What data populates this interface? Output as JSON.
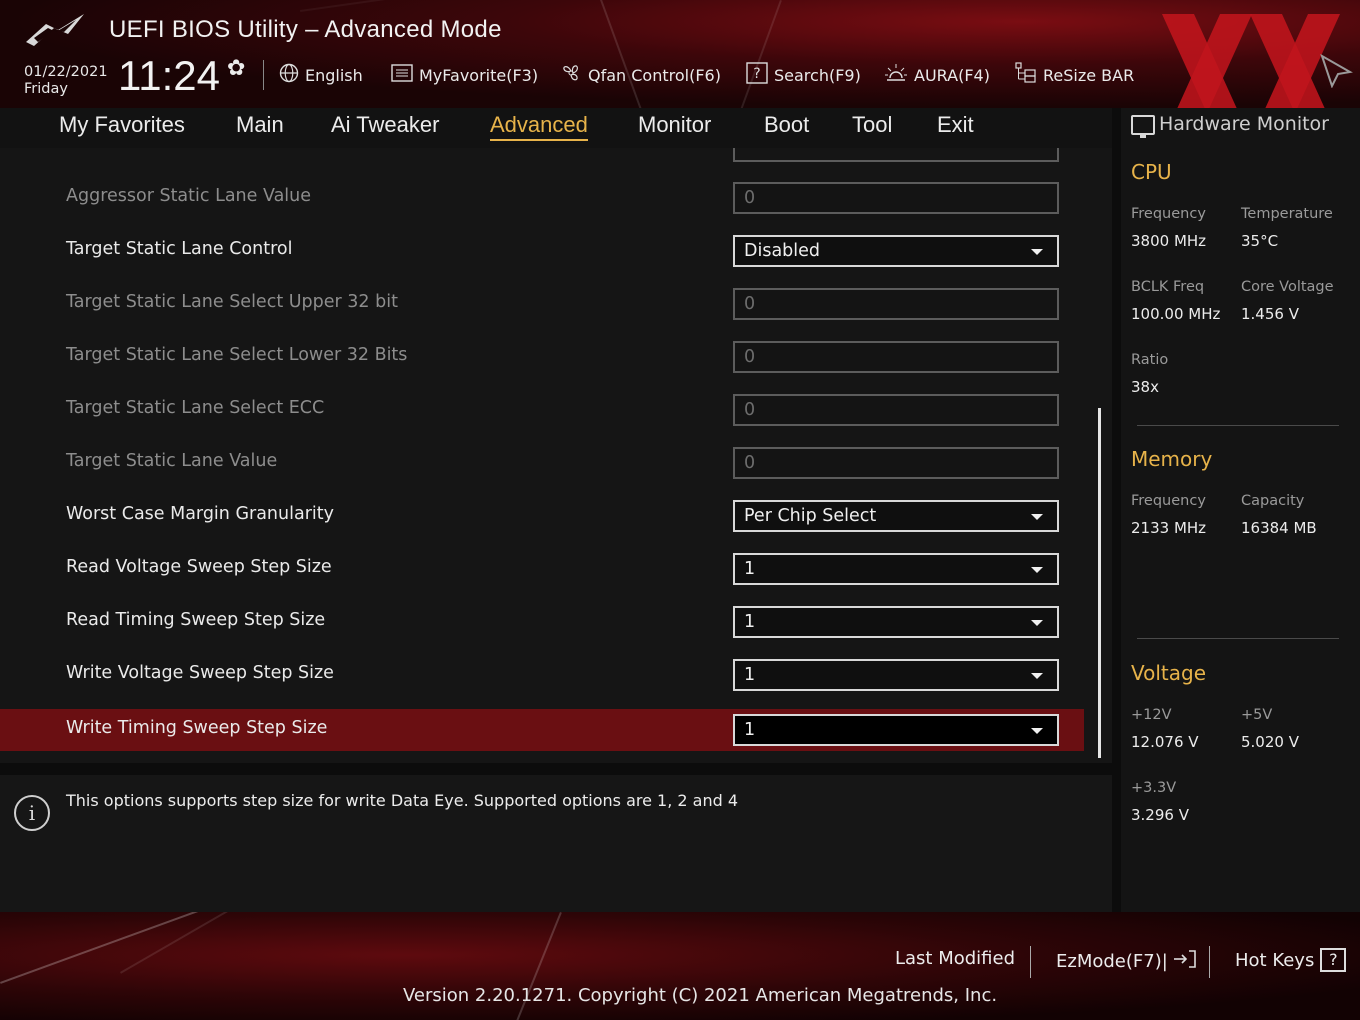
{
  "header": {
    "title": "UEFI BIOS Utility – Advanced Mode",
    "date": "01/22/2021",
    "day": "Friday",
    "time": "11:24",
    "tools": [
      {
        "label": "English",
        "icon": "globe-icon"
      },
      {
        "label": "MyFavorite(F3)",
        "icon": "favorite-list-icon"
      },
      {
        "label": "Qfan Control(F6)",
        "icon": "fan-icon"
      },
      {
        "label": "Search(F9)",
        "icon": "search-help-icon"
      },
      {
        "label": "AURA(F4)",
        "icon": "aura-light-icon"
      },
      {
        "label": "ReSize BAR",
        "icon": "resize-bar-icon"
      }
    ]
  },
  "menu": {
    "items": [
      "My Favorites",
      "Main",
      "Ai Tweaker",
      "Advanced",
      "Monitor",
      "Boot",
      "Tool",
      "Exit"
    ],
    "active": "Advanced"
  },
  "settings": [
    {
      "label": "Aggressor Static Lane Value",
      "value": "0",
      "type": "input",
      "enabled": false
    },
    {
      "label": "Target Static Lane Control",
      "value": "Disabled",
      "type": "select",
      "enabled": true
    },
    {
      "label": "Target Static Lane Select Upper 32 bit",
      "value": "0",
      "type": "input",
      "enabled": false
    },
    {
      "label": "Target Static Lane Select Lower 32 Bits",
      "value": "0",
      "type": "input",
      "enabled": false
    },
    {
      "label": "Target Static Lane Select ECC",
      "value": "0",
      "type": "input",
      "enabled": false
    },
    {
      "label": "Target Static Lane Value",
      "value": "0",
      "type": "input",
      "enabled": false
    },
    {
      "label": "Worst Case Margin Granularity",
      "value": "Per Chip Select",
      "type": "select",
      "enabled": true
    },
    {
      "label": "Read Voltage Sweep Step Size",
      "value": "1",
      "type": "select",
      "enabled": true
    },
    {
      "label": "Read Timing Sweep Step Size",
      "value": "1",
      "type": "select",
      "enabled": true
    },
    {
      "label": "Write Voltage Sweep Step Size",
      "value": "1",
      "type": "select",
      "enabled": true
    },
    {
      "label": "Write Timing Sweep Step Size",
      "value": "1",
      "type": "select",
      "enabled": true,
      "selected": true
    }
  ],
  "help": {
    "text": "This options supports step size for write Data Eye. Supported options are 1, 2 and 4"
  },
  "hw_monitor": {
    "title": "Hardware Monitor",
    "cpu": {
      "title": "CPU",
      "frequency_label": "Frequency",
      "frequency": "3800 MHz",
      "temperature_label": "Temperature",
      "temperature": "35°C",
      "bclk_label": "BCLK Freq",
      "bclk": "100.00 MHz",
      "core_voltage_label": "Core Voltage",
      "core_voltage": "1.456 V",
      "ratio_label": "Ratio",
      "ratio": "38x"
    },
    "memory": {
      "title": "Memory",
      "frequency_label": "Frequency",
      "frequency": "2133 MHz",
      "capacity_label": "Capacity",
      "capacity": "16384 MB"
    },
    "voltage": {
      "title": "Voltage",
      "v12_label": "+12V",
      "v12": "12.076 V",
      "v5_label": "+5V",
      "v5": "5.020 V",
      "v33_label": "+3.3V",
      "v33": "3.296 V"
    }
  },
  "footer": {
    "last_modified": "Last Modified",
    "ezmode": "EzMode(F7)|",
    "hot_keys": "Hot Keys",
    "hot_keys_icon": "?",
    "version": "Version 2.20.1271. Copyright (C) 2021 American Megatrends, Inc."
  },
  "colors": {
    "accent": "#e7b34a",
    "selected_row": "#6a0f12",
    "brand_red": "#c0141c"
  }
}
